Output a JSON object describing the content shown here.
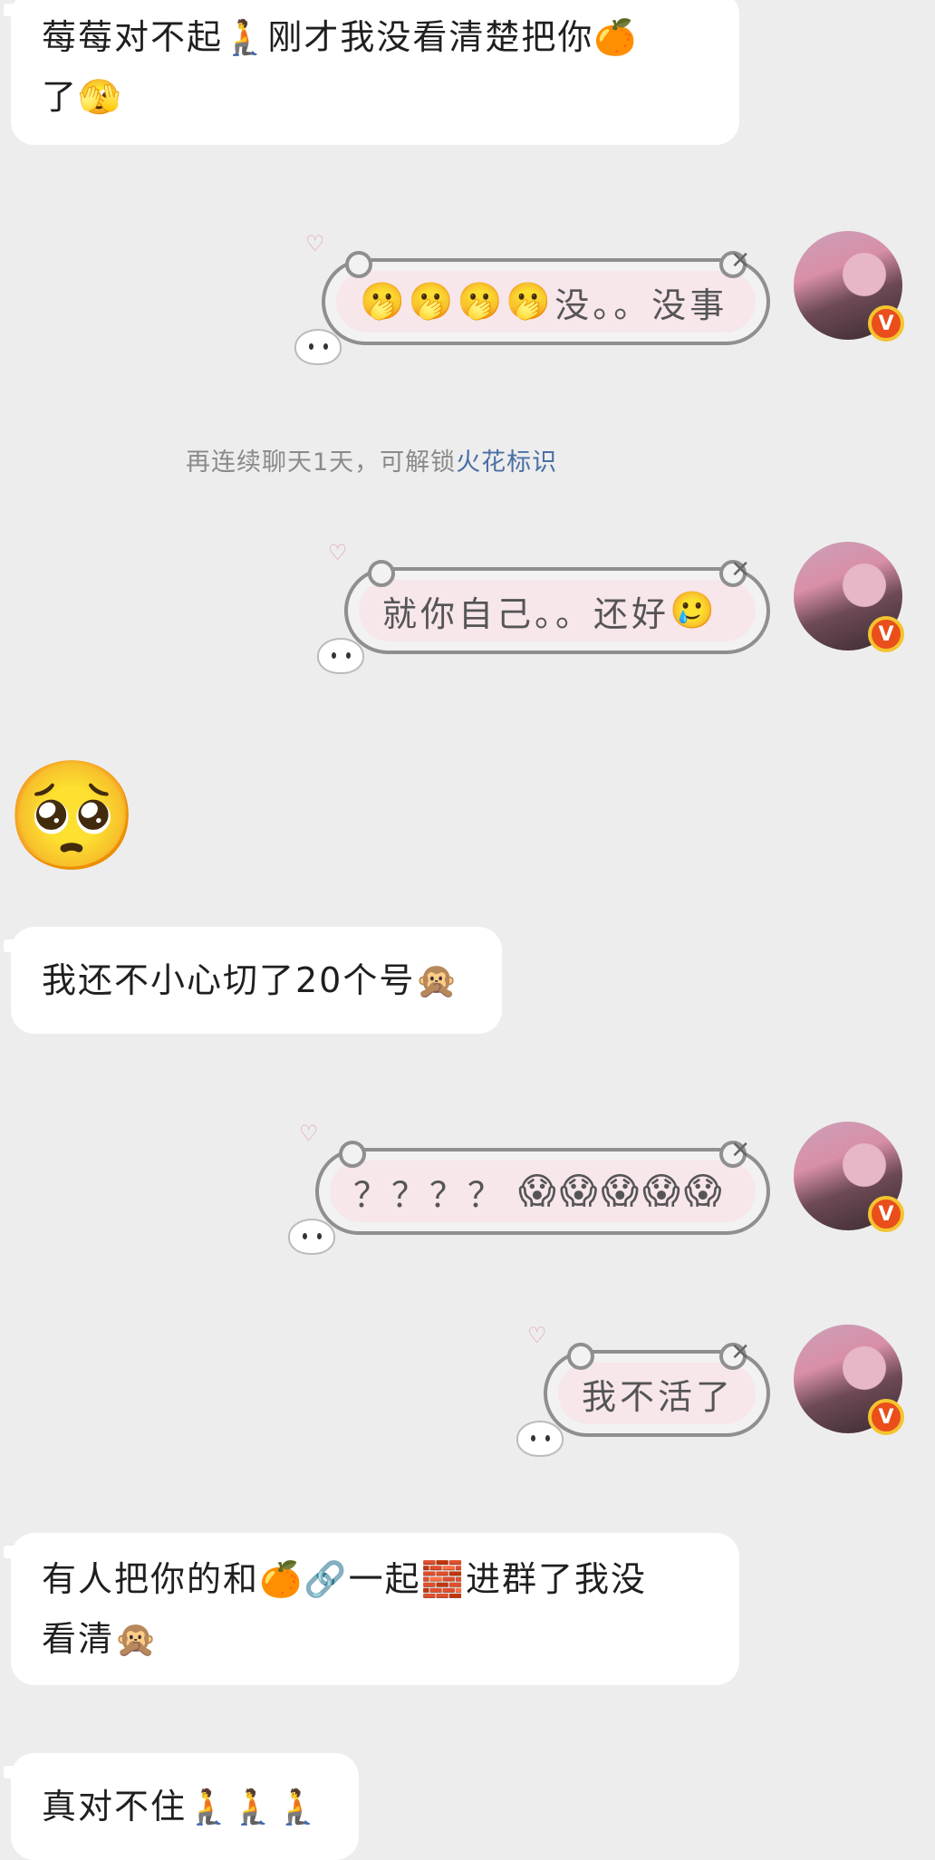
{
  "messages": {
    "m1": {
      "line1": "莓莓对不起🧎刚才我没看清楚把你🍊",
      "line2": "了🫣"
    },
    "m2": {
      "emojis": "🫢🫢🫢🫢",
      "text": "没。。没事"
    },
    "tip": {
      "text": "再连续聊天1天，可解锁",
      "highlight": "火花标识"
    },
    "m3": {
      "text": "就你自己。。还好",
      "emoji": "🥲"
    },
    "m4": {
      "emoji": "🥺"
    },
    "m5": {
      "text": "我还不小心切了20个号🙊"
    },
    "m6": {
      "text": "？？？？",
      "emojis": "😱😱😱😱😱"
    },
    "m7": {
      "text": "我不活了"
    },
    "m8": {
      "line1": "有人把你的和🍊🔗一起🧱进群了我没",
      "line2": "看清🙊"
    },
    "m9": {
      "text": "真对不住🧎🧎🧎"
    }
  },
  "avatar": {
    "badge": "V"
  },
  "decor": {
    "heart": "♡",
    "bow": "✕"
  }
}
